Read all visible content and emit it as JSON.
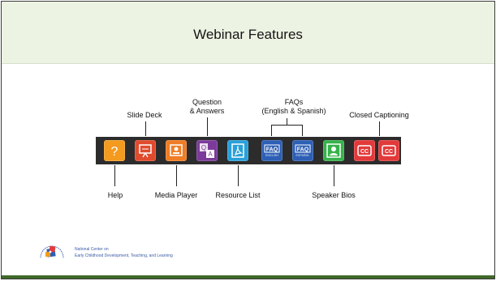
{
  "slide": {
    "title": "Webinar Features"
  },
  "colors": {
    "header_bg": "#edf3e3",
    "toolbar_bg": "#2c2c2c",
    "help": "#f39a1f",
    "slide_deck": "#e04b2d",
    "media_player": "#ef7d25",
    "qa": "#7c3b9a",
    "resource_list": "#2aa0d8",
    "faq": "#2d5fb5",
    "speaker_bios": "#36b24a",
    "closed_captioning": "#e23a3a"
  },
  "callouts": {
    "slide_deck": "Slide Deck",
    "qa_line1": "Question",
    "qa_line2": "& Answers",
    "faqs_line1": "FAQs",
    "faqs_line2": "(English & Spanish)",
    "closed_captioning": "Closed Captioning",
    "help": "Help",
    "media_player": "Media Player",
    "resource_list": "Resource List",
    "speaker_bios": "Speaker Bios"
  },
  "toolbar": {
    "icons": [
      {
        "name": "help-icon",
        "glyph": "?"
      },
      {
        "name": "slide-deck-icon"
      },
      {
        "name": "media-player-icon"
      },
      {
        "name": "qa-icon",
        "glyph_q": "Q",
        "glyph_a": "A"
      },
      {
        "name": "resource-list-icon"
      },
      {
        "name": "faq-english-icon",
        "label": "FAQ",
        "sub": "ENGLISH"
      },
      {
        "name": "faq-spanish-icon",
        "label": "FAQ",
        "sub": "ESPAÑOL"
      },
      {
        "name": "speaker-bios-icon"
      },
      {
        "name": "closed-captioning-icon",
        "label": "CC"
      },
      {
        "name": "closed-captioning-icon",
        "label": "CC"
      }
    ]
  },
  "footer": {
    "org_line1": "National Center on",
    "org_line2": "Early Childhood Development, Teaching, and Learning"
  }
}
